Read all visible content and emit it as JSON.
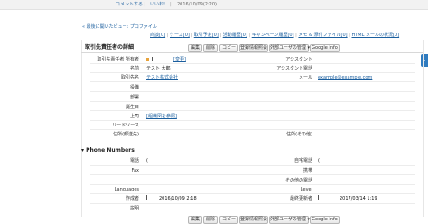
{
  "top": {
    "comment": "コメントする",
    "like": "いいね!",
    "datetime": "2016/10/09(2:20)"
  },
  "related": {
    "back_link": "« 最後に開いたビュー: プロファイル",
    "links": [
      {
        "label": "商談",
        "count": "[0]"
      },
      {
        "label": "ケース",
        "count": "[0]"
      },
      {
        "label": "取引予定",
        "count": "[0]"
      },
      {
        "label": "活動履歴",
        "count": "[0]"
      },
      {
        "label": "キャンペーン履歴",
        "count": "[0]"
      },
      {
        "label": "メモ & 添付ファイル",
        "count": "[0]"
      },
      {
        "label": "HTML メールの状況",
        "count": "[0]"
      }
    ]
  },
  "detail": {
    "title": "取引先責任者の詳細",
    "buttons": {
      "edit": "編集",
      "delete": "削除",
      "copy": "コピー",
      "enable_partner": "登録情報照会",
      "manage_external": "外部ユーザの管理 ▾",
      "google_info": "Google Info"
    },
    "fields": {
      "owner_label": "取引先責任者 所有者",
      "owner_change": "[変更]",
      "name_label": "名前",
      "name_value": "テスト 太郎",
      "account_label": "取引先名",
      "account_value": "テスト株式会社",
      "title_label": "役職",
      "dept_label": "部署",
      "birthdate_label": "誕生日",
      "reports_to_label": "上司",
      "reports_to_link": "[組織図を参照]",
      "lead_source_label": "リードソース",
      "mailing_label": "住所(郵送先)",
      "phone_label": "電話",
      "fax_label": "Fax",
      "languages_label": "Languages",
      "created_label": "作成者",
      "created_value": "2016/10/09 2:18",
      "description_label": "説明",
      "assistant_label": "アシスタント",
      "assistant_phone_label": "アシスタント電話",
      "email_label": "メール",
      "email_value": "example@example.com",
      "other_address_label": "住所(その他)",
      "home_phone_label": "自宅電話",
      "mobile_label": "携帯",
      "other_phone_label": "その他の電話",
      "level_label": "Level",
      "modified_label": "最終更新者",
      "modified_value": "2017/03/14 1:19"
    },
    "phone_section_title": "Phone Numbers",
    "phone_prefix": "("
  },
  "colors": {
    "link": "#1a5e9e",
    "section_divider": "#7a55b8",
    "side_tab": "#2f7bbf"
  }
}
